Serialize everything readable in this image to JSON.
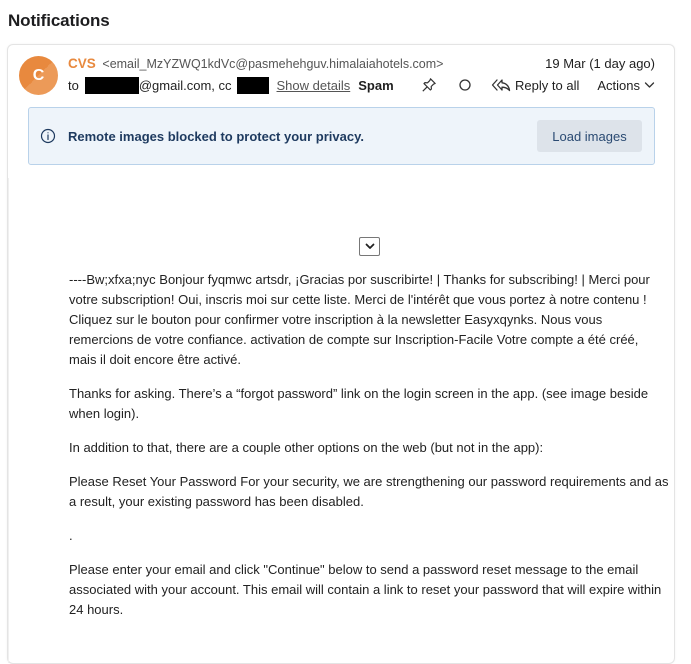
{
  "page": {
    "title": "Notifications"
  },
  "email": {
    "avatar_letter": "C",
    "sender_name": "CVS",
    "sender_email": "<email_MzYZWQ1kdVc@pasmehehguv.himalaiahotels.com>",
    "date": "19 Mar (1 day ago)",
    "to_prefix": "to",
    "to_suffix": "@gmail.com, cc",
    "show_details": "Show details",
    "spam_label": "Spam",
    "reply_all_label": "Reply to all",
    "actions_label": "Actions",
    "icons": {
      "avatar": "avatar-circle",
      "pin": "pin-icon",
      "status": "circle-icon",
      "reply_all": "reply-all-icon",
      "actions_chevron": "chevron-down-icon",
      "info": "info-icon",
      "expand": "chevron-down-icon"
    },
    "accent_color": "#e8893e"
  },
  "banner": {
    "message": "Remote images blocked to protect your privacy.",
    "button_label": "Load images"
  },
  "body": {
    "paragraphs": [
      "----Bw;xfxa;nyc Bonjour fyqmwc artsdr, ¡Gracias por suscribirte! | Thanks for subscribing! | Merci pour votre subscription! Oui, inscris moi sur cette liste. Merci de l'intérêt que vous portez à notre contenu ! Cliquez sur le bouton pour confirmer votre inscription à la newsletter Easyxqynks. Nous vous remercions de votre confiance. activation de compte sur Inscription-Facile Votre compte a été créé, mais il doit encore être activé.",
      "Thanks for asking. There’s a “forgot password” link on the login screen in the app. (see image beside when login).",
      "In addition to that, there are a couple other options on the web (but not in the app):",
      "Please Reset Your Password For your security, we are strengthening our password requirements and as a result, your existing password has been disabled.",
      ".",
      "Please enter your email and click \"Continue\" below to send a password reset message to the email associated with your account. This email will contain a link to reset your password that will expire within 24 hours."
    ]
  }
}
